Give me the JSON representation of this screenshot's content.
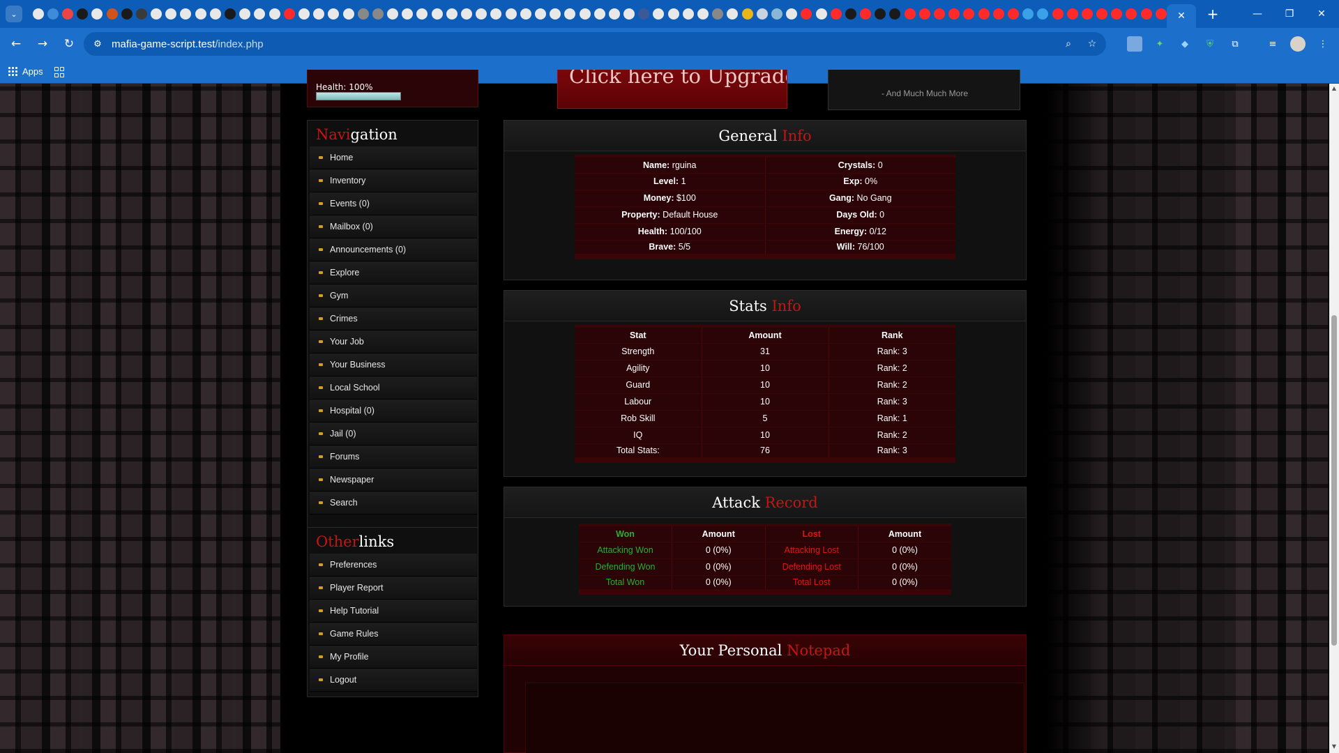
{
  "browser": {
    "url_host": "mafia-game-script.test",
    "url_path": "/index.php",
    "bookmarks": {
      "apps_label": "Apps"
    },
    "tab_favicon_colors": [
      "#e8e8e8",
      "#3d8bd9",
      "#e44",
      "#1a1a1a",
      "#e8e8e8",
      "#d0531c",
      "#1a1a1a",
      "#3a3a3a",
      "#e8e8e8",
      "#e8e8e8",
      "#e8e8e8",
      "#e8e8e8",
      "#e8e8e8",
      "#1a1a1a",
      "#e8e8e8",
      "#e8e8e8",
      "#e8e8e8",
      "#ff2a2a",
      "#e8e8e8",
      "#e8e8e8",
      "#e8e8e8",
      "#e8e8e8",
      "#888",
      "#888",
      "#e8e8e8",
      "#e8e8e8",
      "#e8e8e8",
      "#e8e8e8",
      "#e8e8e8",
      "#e8e8e8",
      "#e8e8e8",
      "#e8e8e8",
      "#e8e8e8",
      "#e8e8e8",
      "#e8e8e8",
      "#e8e8e8",
      "#e8e8e8",
      "#e8e8e8",
      "#e8e8e8",
      "#e8e8e8",
      "#e8e8e8",
      "#3b5998",
      "#e8e8e8",
      "#e8e8e8",
      "#e8e8e8",
      "#e8e8e8",
      "#888",
      "#e8e8e8",
      "#e8b51b",
      "#c9d3e0",
      "#8ab6d6",
      "#e8e8e8",
      "#ff2a2a",
      "#e8e8e8",
      "#ff2a2a",
      "#1a1a1a",
      "#ff2a2a",
      "#1a1a1a",
      "#1a1a1a",
      "#ff2a2a",
      "#ff2a2a",
      "#ff2a2a",
      "#ff2a2a",
      "#ff2a2a",
      "#ff2a2a",
      "#ff2a2a",
      "#ff2a2a",
      "#3aa0e8",
      "#3aa0e8",
      "#ff2a2a",
      "#ff2a2a",
      "#ff2a2a",
      "#ff2a2a",
      "#ff2a2a",
      "#ff2a2a",
      "#ff2a2a",
      "#ff2a2a",
      "#ff2a2a",
      "#ff2a2a",
      "#e8b51b"
    ]
  },
  "sidebar": {
    "health_label": "Health: 100%",
    "health_fraction": 1.0,
    "navigation": {
      "title_red": "Navi",
      "title_white": "gation",
      "items": [
        {
          "label": "Home"
        },
        {
          "label": "Inventory"
        },
        {
          "label": "Events (0)"
        },
        {
          "label": "Mailbox (0)"
        },
        {
          "label": "Announcements (0)"
        },
        {
          "label": "Explore"
        },
        {
          "label": "Gym"
        },
        {
          "label": "Crimes"
        },
        {
          "label": "Your Job"
        },
        {
          "label": "Your Business"
        },
        {
          "label": "Local School"
        },
        {
          "label": "Hospital (0)"
        },
        {
          "label": "Jail (0)"
        },
        {
          "label": "Forums"
        },
        {
          "label": "Newspaper"
        },
        {
          "label": "Search"
        }
      ]
    },
    "other": {
      "title_red": "Other",
      "title_white": "links",
      "items": [
        {
          "label": "Preferences"
        },
        {
          "label": "Player Report"
        },
        {
          "label": "Help Tutorial"
        },
        {
          "label": "Game Rules"
        },
        {
          "label": "My Profile"
        },
        {
          "label": "Logout"
        }
      ]
    }
  },
  "upgrade": {
    "label": "Click here to Upgrade!"
  },
  "more_box": {
    "text": "- And Much Much More"
  },
  "general": {
    "title_white": "General ",
    "title_red": "Info",
    "rows": [
      {
        "l_key": "Name:",
        "l_val": " rguina",
        "r_key": "Crystals:",
        "r_val": " 0"
      },
      {
        "l_key": "Level:",
        "l_val": " 1",
        "r_key": "Exp:",
        "r_val": " 0%"
      },
      {
        "l_key": "Money:",
        "l_val": " $100",
        "r_key": "Gang:",
        "r_val": " No Gang"
      },
      {
        "l_key": "Property:",
        "l_val": " Default House",
        "r_key": "Days Old:",
        "r_val": " 0"
      },
      {
        "l_key": "Health:",
        "l_val": " 100/100",
        "r_key": "Energy:",
        "r_val": " 0/12"
      },
      {
        "l_key": "Brave:",
        "l_val": " 5/5",
        "r_key": "Will:",
        "r_val": " 76/100"
      }
    ]
  },
  "stats": {
    "title_white": "Stats ",
    "title_red": "Info",
    "headers": [
      "Stat",
      "Amount",
      "Rank"
    ],
    "rows": [
      [
        "Strength",
        "31",
        "Rank: 3"
      ],
      [
        "Agility",
        "10",
        "Rank: 2"
      ],
      [
        "Guard",
        "10",
        "Rank: 2"
      ],
      [
        "Labour",
        "10",
        "Rank: 3"
      ],
      [
        "Rob Skill",
        "5",
        "Rank: 1"
      ],
      [
        "IQ",
        "10",
        "Rank: 2"
      ],
      [
        "Total Stats:",
        "76",
        "Rank: 3"
      ]
    ]
  },
  "attack": {
    "title_white": "Attack ",
    "title_red": "Record",
    "headers": [
      "Won",
      "Amount",
      "Lost",
      "Amount"
    ],
    "rows": [
      [
        "Attacking Won",
        "0 (0%)",
        "Attacking Lost",
        "0 (0%)"
      ],
      [
        "Defending Won",
        "0 (0%)",
        "Defending Lost",
        "0 (0%)"
      ],
      [
        "Total Won",
        "0 (0%)",
        "Total Lost",
        "0 (0%)"
      ]
    ]
  },
  "notepad": {
    "title_white": "Your Personal ",
    "title_red": "Notepad"
  }
}
